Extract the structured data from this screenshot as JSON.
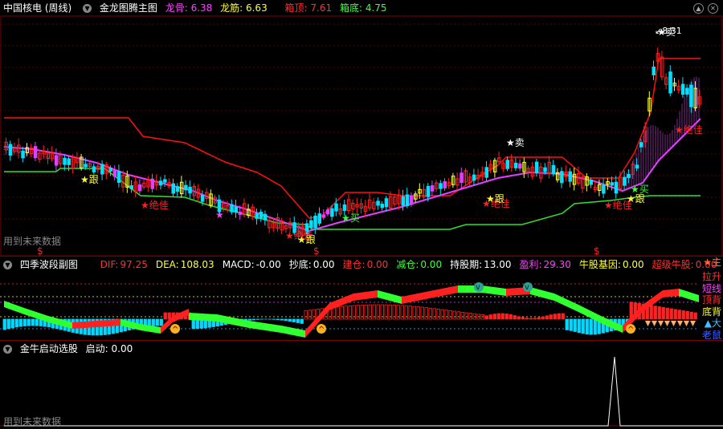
{
  "main": {
    "stock_title": "中国核电 (周线)",
    "indicator_name": "金龙图腾主图",
    "long_gu_label": "龙骨:",
    "long_gu_value": "6.38",
    "long_jin_label": "龙筋:",
    "long_jin_value": "6.63",
    "box_top_label": "箱顶:",
    "box_top_value": "7.61",
    "box_bottom_label": "箱底:",
    "box_bottom_value": "4.75",
    "watermark": "用到未来数据",
    "signals": {
      "sell": "卖",
      "buy": "买",
      "follow": "跟",
      "great": "绝佳"
    },
    "price_high_label": "8.31",
    "dollar_marker": "$"
  },
  "sub": {
    "title": "四季波段副图",
    "metrics": [
      {
        "label": "DIF:",
        "value": "97.25",
        "color": "#ff3030"
      },
      {
        "label": "DEA:",
        "value": "108.03",
        "color": "#ffff40"
      },
      {
        "label": "MACD:",
        "value": "-0.00",
        "color": "#ffffff"
      },
      {
        "label": "抄底:",
        "value": "0.00",
        "color": "#ffffff"
      },
      {
        "label": "建仓:",
        "value": "0.00",
        "color": "#ff3030"
      },
      {
        "label": "减仓:",
        "value": "0.00",
        "color": "#40ff40"
      },
      {
        "label": "持股期:",
        "value": "13.00",
        "color": "#ffffff"
      },
      {
        "label": "盈利:",
        "value": "29.30",
        "color": "#ff40ff"
      },
      {
        "label": "牛股基因:",
        "value": "0.00",
        "color": "#ffff40"
      },
      {
        "label": "超级牛股:",
        "value": "0.00",
        "color": "#ff3030"
      }
    ],
    "right_labels": [
      {
        "text": "拉升",
        "color": "#ff3030"
      },
      {
        "text": "短线",
        "color": "#ff40ff"
      },
      {
        "text": "顶背",
        "color": "#ff3030"
      },
      {
        "text": "底背",
        "color": "#ffff40"
      },
      {
        "text": "▲大",
        "color": "#40c0ff"
      },
      {
        "text": "老鼠",
        "color": "#4060ff"
      }
    ],
    "corner_label": "★主"
  },
  "start": {
    "title": "金牛启动选股",
    "metric_label": "启动:",
    "metric_value": "0.00",
    "watermark": "用到未来数据"
  },
  "colors": {
    "up": "#ff2020",
    "down": "#00e0ff",
    "ma_magenta": "#e040ff",
    "support_green": "#30e030",
    "box_red": "#ff1010"
  }
}
